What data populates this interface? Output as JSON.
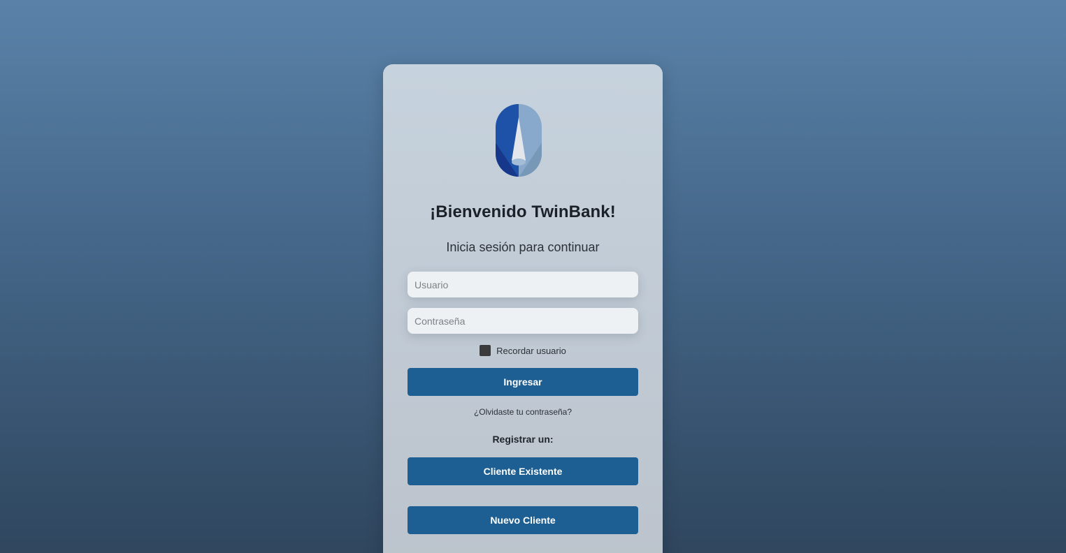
{
  "app": {
    "title": "¡Bienvenido TwinBank!",
    "subtitle": "Inicia sesión para continuar",
    "logo_icon": "twinbank-logo-icon"
  },
  "form": {
    "username_placeholder": "Usuario",
    "password_placeholder": "Contraseña",
    "remember_label": "Recordar usuario",
    "login_label": "Ingresar",
    "forgot_label": "¿Olvidaste tu contraseña?"
  },
  "register": {
    "label": "Registrar un:",
    "existing_client_label": "Cliente Existente",
    "new_client_label": "Nuevo Cliente"
  },
  "colors": {
    "primary_button": "#1d5f92",
    "background_top": "#5a82a8",
    "background_bottom": "#2f465e"
  }
}
